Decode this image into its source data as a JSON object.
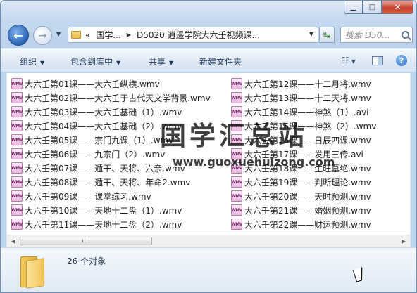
{
  "window": {
    "controls": {
      "minimize": "▁",
      "maximize": "□",
      "close": "✕"
    }
  },
  "navigation": {
    "back_label": "←",
    "forward_label": "→",
    "dropdown": "▼",
    "address": {
      "prefix": "«",
      "segments": [
        "国学...",
        "D5020 逍遥学院大六壬视频课..."
      ],
      "separator": "▶",
      "dropdown": "▼"
    },
    "refresh_label": "↹",
    "search_placeholder": "搜索 D50..."
  },
  "toolbar": {
    "items": [
      "组织",
      "包含到库中",
      "共享",
      "新建文件夹"
    ],
    "caret": "▼",
    "view_icon": "☷",
    "help_label": "?"
  },
  "file_icon_label": "WMV",
  "files_left": [
    "大六壬第01课——大六壬纵横.wmv",
    "大六壬第02课——大六壬于古代天文学背景.wmv",
    "大六壬第03课——大六壬基础（1）.wmv",
    "大六壬第04课——大六壬基础（2）.wmv",
    "大六壬第05课——宗门九课（1）.wmv",
    "大六壬第06课——九宗门（2）.wmv",
    "大六壬第07课——遁干、天将、六亲.wmv",
    "大六壬第08课——遁干、天将、年命2.wmv",
    "大六壬第09课——课堂练习.wmv",
    "大六壬第10课——天地十二盘（1）.wmv",
    "大六壬第11课——天地十二盘（2）.wmv"
  ],
  "files_right": [
    "大六壬第12课——十二月将.wmv",
    "大六壬第13课——十二天将.wmv",
    "大六壬第14课——神煞（1）.avi",
    "大六壬第15课——神煞（2）.wmv",
    "大六壬第16课——日辰四课.wmv",
    "大六壬第17课——发用三传.avi",
    "大六壬第18课——生旺墓绝.wmv",
    "大六壬第19课——判断理论.wmv",
    "大六壬第20课——天时预测.wmv",
    "大六壬第21课——婚姻预测.wmv",
    "大六壬第22课——财运预测.wmv"
  ],
  "watermark": {
    "title": "国学汇总站",
    "url": "www.guoxuehuizong.com"
  },
  "scrollbar": {
    "left_arrow": "◀",
    "right_arrow": "▶"
  },
  "details": {
    "object_count": "26 个对象"
  }
}
